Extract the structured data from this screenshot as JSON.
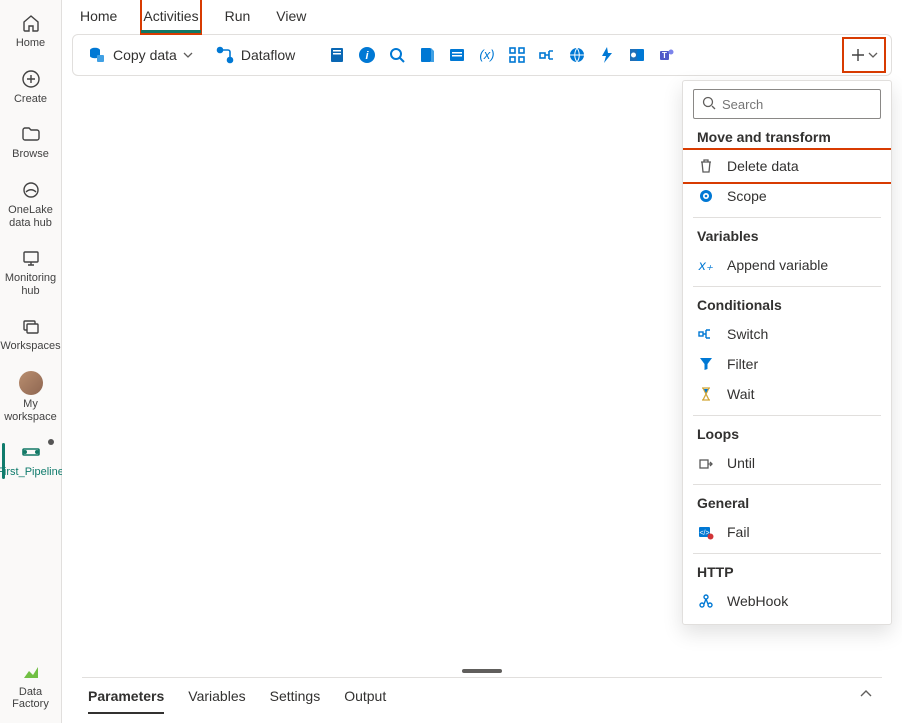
{
  "rail": {
    "home": "Home",
    "create": "Create",
    "browse": "Browse",
    "onelake": "OneLake data hub",
    "monitoring": "Monitoring hub",
    "workspaces": "Workspaces",
    "myworkspace": "My workspace",
    "pipeline": "First_Pipeline",
    "datafactory": "Data Factory"
  },
  "tabs": {
    "home": "Home",
    "activities": "Activities",
    "run": "Run",
    "view": "View"
  },
  "toolbar": {
    "copydata": "Copy data",
    "dataflow": "Dataflow"
  },
  "dropdown": {
    "search_placeholder": "Search",
    "sections": {
      "move": "Move and transform",
      "variables": "Variables",
      "conditionals": "Conditionals",
      "loops": "Loops",
      "general": "General",
      "http": "HTTP"
    },
    "items": {
      "delete": "Delete data",
      "scope": "Scope",
      "append": "Append variable",
      "switch": "Switch",
      "filter": "Filter",
      "wait": "Wait",
      "until": "Until",
      "fail": "Fail",
      "webhook": "WebHook"
    }
  },
  "bottom": {
    "parameters": "Parameters",
    "variables": "Variables",
    "settings": "Settings",
    "output": "Output"
  },
  "colors": {
    "accent_blue": "#0078d4",
    "accent_teal": "#117865",
    "highlight": "#d83b01"
  }
}
